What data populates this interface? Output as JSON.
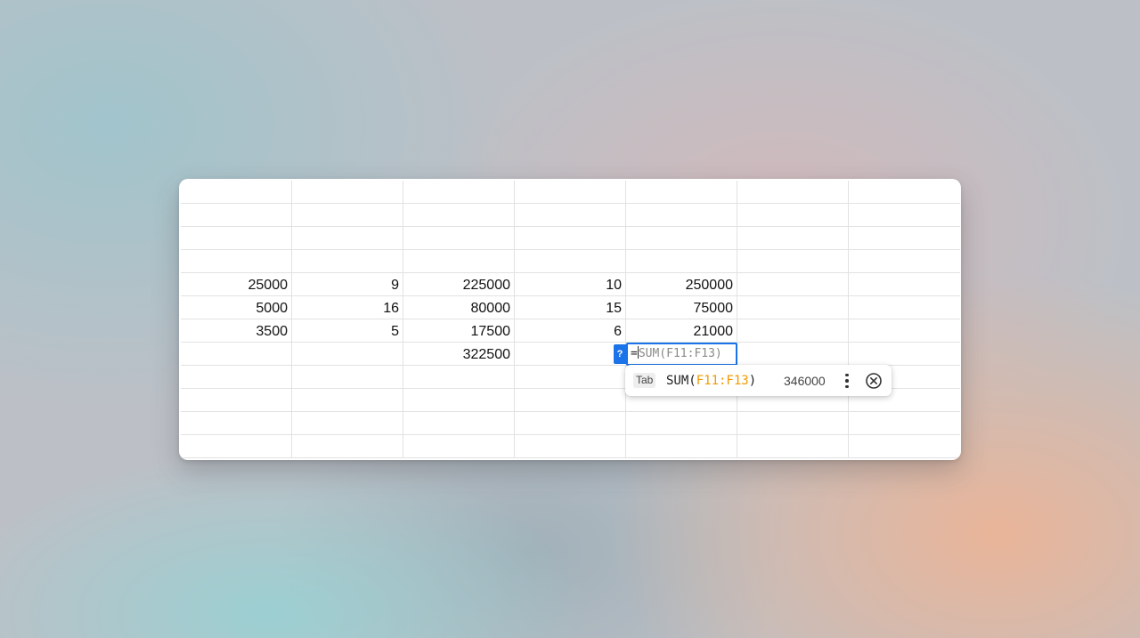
{
  "sheet": {
    "rows": [
      [
        "",
        "",
        "",
        "",
        "",
        "",
        ""
      ],
      [
        "",
        "",
        "",
        "",
        "",
        "",
        ""
      ],
      [
        "",
        "",
        "",
        "",
        "",
        "",
        ""
      ],
      [
        "",
        "",
        "",
        "",
        "",
        "",
        ""
      ],
      [
        "25000",
        "9",
        "225000",
        "10",
        "250000",
        "",
        ""
      ],
      [
        "5000",
        "16",
        "80000",
        "15",
        "75000",
        "",
        ""
      ],
      [
        "3500",
        "5",
        "17500",
        "6",
        "21000",
        "",
        ""
      ],
      [
        "",
        "",
        "322500",
        "",
        "",
        "",
        ""
      ],
      [
        "",
        "",
        "",
        "",
        "",
        "",
        ""
      ],
      [
        "",
        "",
        "",
        "",
        "",
        "",
        ""
      ],
      [
        "",
        "",
        "",
        "",
        "",
        "",
        ""
      ],
      [
        "",
        "",
        "",
        "",
        "",
        "",
        ""
      ]
    ]
  },
  "editor": {
    "typed": "=",
    "ghost": "SUM(F11:F13)",
    "help_label": "?"
  },
  "suggestion": {
    "key_hint": "Tab",
    "fn_name": "SUM(",
    "fn_range": "F11:F13",
    "fn_close": ")",
    "result": "346000",
    "more_icon": "more-vertical-icon",
    "close_icon": "close-circle-icon"
  },
  "colors": {
    "selection": "#1a73e8",
    "range_highlight": "#f29900"
  }
}
